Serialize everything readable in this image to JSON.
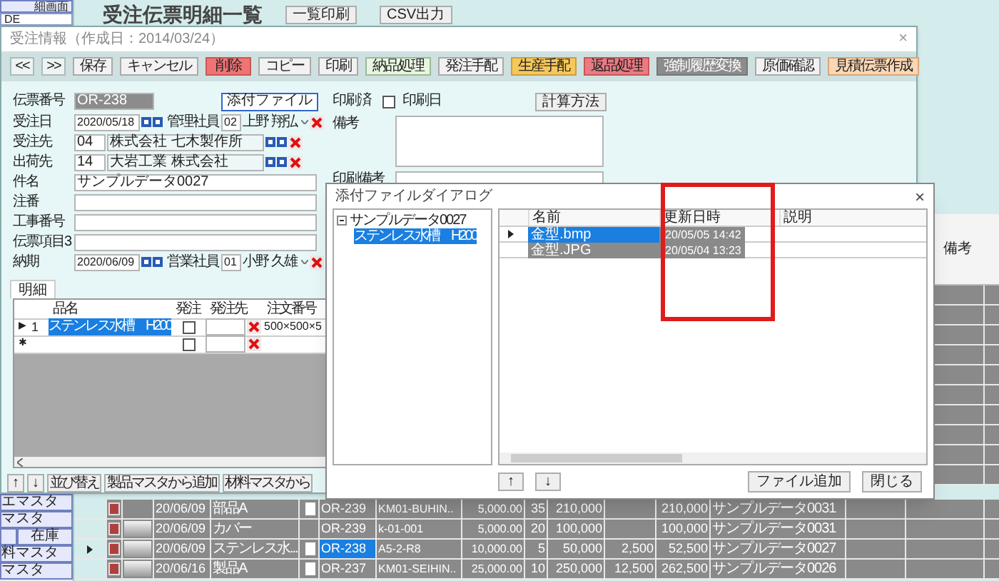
{
  "app": {
    "title": "受注伝票明細一覧",
    "buttons": [
      "一覧印刷",
      "CSV出力"
    ]
  },
  "sidebar": {
    "top_item": "細画面",
    "top_field": "DE",
    "items": [
      {
        "kind": "single",
        "label": "エマスタ"
      },
      {
        "kind": "single",
        "label": "マスタ"
      },
      {
        "kind": "pair",
        "label": "在庫"
      },
      {
        "kind": "single",
        "label": "料マスタ"
      },
      {
        "kind": "single",
        "label": "マスタ"
      }
    ]
  },
  "background_table": {
    "header": "備考",
    "rows": [
      {
        "date": "20/06/09",
        "item": "部品A",
        "attachment": true,
        "bar_shown": false,
        "order_no": "OR-239",
        "code": "KM01-BUHIN..",
        "price": "5,000.00",
        "qty": "35",
        "amount": "210,000",
        "total": "210,000",
        "memo": "サンプルデータ0031",
        "selected": false
      },
      {
        "date": "20/06/09",
        "item": "カバー",
        "attachment": false,
        "bar_shown": true,
        "order_no": "OR-239",
        "code": "k-01-001",
        "price": "5,000.00",
        "qty": "20",
        "amount": "100,000",
        "total": "100,000",
        "memo": "サンプルデータ0031",
        "selected": false
      },
      {
        "date": "20/06/09",
        "item": "ステンレス水...",
        "attachment": true,
        "bar_shown": true,
        "order_no": "OR-238",
        "code": "A5-2-R8",
        "price": "10,000.00",
        "qty": "5",
        "amount": "50,000",
        "tax": "2,500",
        "total": "52,500",
        "memo": "サンプルデータ0027",
        "selected": true
      },
      {
        "date": "20/06/16",
        "item": "製品A",
        "attachment": true,
        "bar_shown": true,
        "order_no": "OR-237",
        "code": "KM01-SEIHIN..",
        "price": "25,000.00",
        "qty": "10",
        "amount": "250,000",
        "tax": "12,500",
        "total": "262,500",
        "memo": "サンプルデータ0026",
        "selected": false
      }
    ]
  },
  "order_window": {
    "title": "受注情報（作成日：2014/03/24）",
    "close_label": "×",
    "toolbar": [
      {
        "label": "<<",
        "kind": "nav"
      },
      {
        "label": ">>",
        "kind": "nav"
      },
      {
        "label": "保存",
        "kind": "normal"
      },
      {
        "label": "キャンセル",
        "kind": "normal"
      },
      {
        "label": "削除",
        "kind": "danger"
      },
      {
        "label": "コピー",
        "kind": "normal"
      },
      {
        "label": "印刷",
        "kind": "normal"
      },
      {
        "label": "納品処理",
        "kind": "green"
      },
      {
        "label": "発注手配",
        "kind": "normal"
      },
      {
        "label": "生産手配",
        "kind": "yellow"
      },
      {
        "label": "返品処理",
        "kind": "pink"
      },
      {
        "label": "強制履歴変換",
        "kind": "disabled"
      },
      {
        "label": "原価確認",
        "kind": "normal"
      },
      {
        "label": "見積伝票作成",
        "kind": "peach"
      }
    ],
    "slip_no": {
      "label": "伝票番号",
      "value": "OR-238"
    },
    "attach_button": "添付ファイル",
    "order_date": {
      "label": "受注日",
      "value": "2020/05/18"
    },
    "manager": {
      "label": "管理社員",
      "code": "02",
      "name": "上野 翔弘"
    },
    "customer": {
      "label": "受注先",
      "code": "04",
      "name": "株式会社 七木製作所"
    },
    "ship_to": {
      "label": "出荷先",
      "code": "14",
      "name": "大岩工業 株式会社"
    },
    "text_fields": [
      {
        "label": "件名",
        "value": "サンプルデータ0027"
      },
      {
        "label": "注番"
      },
      {
        "label": "工事番号"
      },
      {
        "label": "伝票項目3"
      }
    ],
    "due_date": {
      "label": "納期",
      "value": "2020/06/09"
    },
    "sales": {
      "label": "営業社員",
      "code": "01",
      "name": "小野 久雄"
    },
    "printed": {
      "label": "印刷済",
      "checked": false
    },
    "print_date_label": "印刷日",
    "calc_button": "計算方法",
    "remarks_label": "備考",
    "print_remarks_label": "印刷備考",
    "detail_tab": {
      "label": "明細",
      "selected": true
    },
    "detail_columns": [
      "品名",
      "発注",
      "発注先",
      "注文番号"
    ],
    "detail_rows": [
      {
        "marker": "▶",
        "number": "1",
        "name": "ステンレス水槽　H200",
        "ordered": false,
        "order_no": "500×500×5",
        "selected": true
      },
      {
        "marker": "✱",
        "ordered": false,
        "selected": false
      }
    ],
    "bottom_buttons": [
      "↑",
      "↓",
      "並び替え",
      "製品マスタから追加",
      "材料マスタから"
    ]
  },
  "attach_dialog": {
    "title": "添付ファイルダイアログ",
    "close_label": "×",
    "tree": [
      {
        "label": "サンプルデータ0027",
        "expanded": true,
        "selected": false,
        "children": [
          {
            "label": "ステンレス水槽　H200",
            "selected": true
          }
        ]
      }
    ],
    "columns": [
      "名前",
      "更新日時",
      "説明"
    ],
    "files": [
      {
        "name": "金型.bmp",
        "updated": "20/05/05 14:42",
        "selected": true
      },
      {
        "name": "金型.JPG",
        "updated": "20/05/04 13:23",
        "selected": false
      }
    ],
    "move_buttons": [
      "↑",
      "↓"
    ],
    "buttons": [
      "ファイル追加",
      "閉じる"
    ]
  }
}
